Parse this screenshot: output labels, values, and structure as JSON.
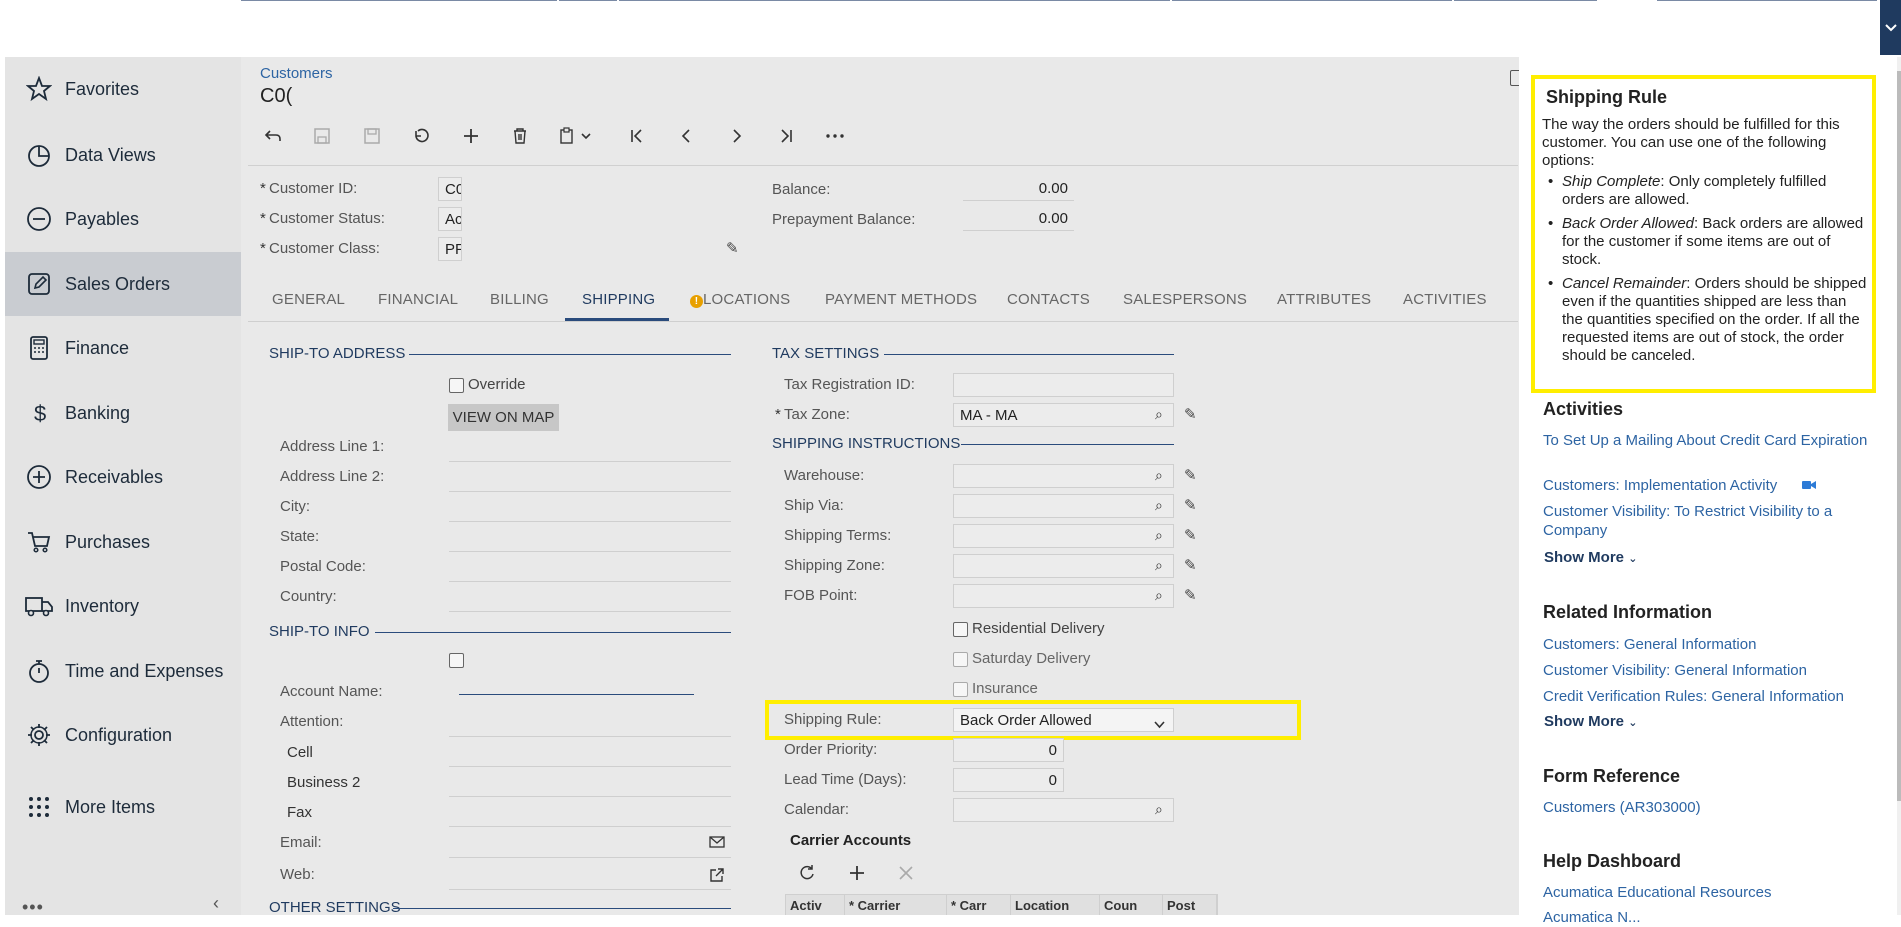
{
  "topbar": {
    "toggle_icon": "chevron-down-icon"
  },
  "sidebar": {
    "items": [
      {
        "label": "Favorites",
        "icon": "star-icon"
      },
      {
        "label": "Data Views",
        "icon": "pie-chart-icon"
      },
      {
        "label": "Payables",
        "icon": "minus-circle-icon"
      },
      {
        "label": "Sales Orders",
        "icon": "edit-icon"
      },
      {
        "label": "Finance",
        "icon": "calculator-icon"
      },
      {
        "label": "Banking",
        "icon": "dollar-icon"
      },
      {
        "label": "Receivables",
        "icon": "plus-circle-icon"
      },
      {
        "label": "Purchases",
        "icon": "cart-icon"
      },
      {
        "label": "Inventory",
        "icon": "truck-icon"
      },
      {
        "label": "Time and Expenses",
        "icon": "stopwatch-icon"
      },
      {
        "label": "Configuration",
        "icon": "gear-icon"
      },
      {
        "label": "More Items",
        "icon": "grid-dots-icon"
      }
    ],
    "active": "Sales Orders",
    "bottom_dots": "•••",
    "collapse": "‹"
  },
  "main": {
    "breadcrumb": "Customers",
    "title": "C0(",
    "summary": {
      "customer_id_label": "Customer ID:",
      "customer_id_value": "C0",
      "customer_status_label": "Customer Status:",
      "customer_status_value": "Ac",
      "customer_class_label": "Customer Class:",
      "customer_class_value": "PF",
      "balance_label": "Balance:",
      "balance_value": "0.00",
      "prepayment_label": "Prepayment Balance:",
      "prepayment_value": "0.00"
    },
    "tabs": [
      "GENERAL",
      "FINANCIAL",
      "BILLING",
      "SHIPPING",
      "LOCATIONS",
      "PAYMENT METHODS",
      "CONTACTS",
      "SALESPERSONS",
      "ATTRIBUTES",
      "ACTIVITIES"
    ],
    "active_tab": "SHIPPING",
    "locations_warning": "!",
    "ship_to_address": {
      "section": "SHIP-TO ADDRESS",
      "override": "Override",
      "view_on_map": "VIEW ON MAP",
      "address_line1": "Address Line 1:",
      "address_line2": "Address Line 2:",
      "city": "City:",
      "state": "State:",
      "postal_code": "Postal Code:",
      "country": "Country:"
    },
    "ship_to_info": {
      "section": "SHIP-TO INFO",
      "account_name": "Account Name:",
      "attention": "Attention:",
      "cell": "Cell",
      "business2": "Business 2",
      "fax": "Fax",
      "email": "Email:",
      "web": "Web:"
    },
    "other_settings": "OTHER SETTINGS",
    "tax_settings": {
      "section": "TAX SETTINGS",
      "tax_registration_label": "Tax Registration ID:",
      "tax_zone_label": "Tax Zone:",
      "tax_zone_value": "MA - MA"
    },
    "shipping_instructions": {
      "section": "SHIPPING INSTRUCTIONS",
      "warehouse": "Warehouse:",
      "ship_via": "Ship Via:",
      "shipping_terms": "Shipping Terms:",
      "shipping_zone": "Shipping Zone:",
      "fob_point": "FOB Point:",
      "residential": "Residential Delivery",
      "saturday": "Saturday Delivery",
      "insurance": "Insurance",
      "shipping_rule_label": "Shipping Rule:",
      "shipping_rule_value": "Back Order Allowed",
      "order_priority_label": "Order Priority:",
      "order_priority_value": "0",
      "lead_time_label": "Lead Time (Days):",
      "lead_time_value": "0",
      "calendar_label": "Calendar:"
    },
    "carrier_accounts": {
      "title": "Carrier Accounts",
      "columns": [
        "Activ",
        "* Carrier",
        "* Carr",
        "Location",
        "Coun",
        "Post"
      ]
    }
  },
  "help": {
    "shipping_rule": {
      "title": "Shipping Rule",
      "description": "The way the orders should be fulfilled for this customer. You can use one of the following options:",
      "options": [
        {
          "term": "Ship Complete",
          "text": ": Only completely fulfilled orders are allowed."
        },
        {
          "term": "Back Order Allowed",
          "text": ": Back orders are allowed for the customer if some items are out of stock."
        },
        {
          "term": "Cancel Remainder",
          "text": ": Orders should be shipped even if the quantities shipped are less than the quantities specified on the order. If all the requested items are out of stock, the order should be canceled."
        }
      ]
    },
    "activities": {
      "title": "Activities",
      "links": [
        "To Set Up a Mailing About Credit Card Expiration",
        "Customers: Implementation Activity",
        "Customer Visibility: To Restrict Visibility to a Company"
      ],
      "show_more": "Show More"
    },
    "related": {
      "title": "Related Information",
      "links": [
        "Customers: General Information",
        "Customer Visibility: General Information",
        "Credit Verification Rules: General Information"
      ],
      "show_more": "Show More"
    },
    "form_reference": {
      "title": "Form Reference",
      "link": "Customers (AR303000)"
    },
    "help_dashboard": {
      "title": "Help Dashboard",
      "link": "Acumatica Educational Resources",
      "link2_partial": "Acumatica N..."
    }
  },
  "colors": {
    "accent": "#1f3a5f",
    "link": "#2d64a3",
    "highlight": "#ffee00"
  }
}
